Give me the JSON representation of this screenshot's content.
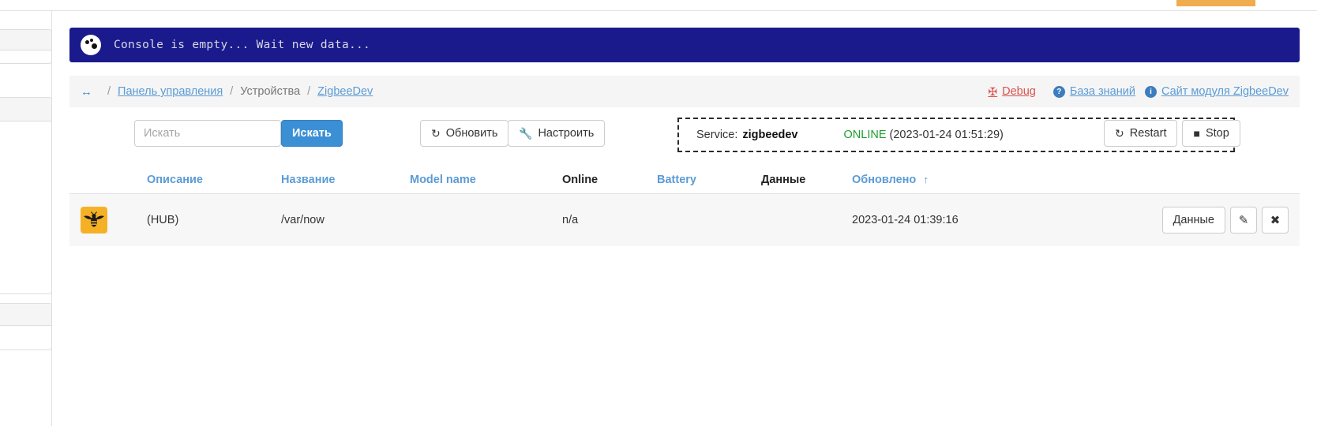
{
  "console": {
    "icon": "console-dots-icon",
    "message": "Console is empty... Wait new data..."
  },
  "breadcrumb": {
    "toggle_icon": "arrows-left-right-icon",
    "sep": "/",
    "items": [
      {
        "label": "Панель управления",
        "type": "link"
      },
      {
        "label": "Устройства",
        "type": "plain"
      },
      {
        "label": "ZigbeeDev",
        "type": "link"
      }
    ],
    "actions": {
      "debug_label": "Debug",
      "debug_icon": "crosshair-icon",
      "debug_color": "#d9534f",
      "kb_badge": "?",
      "kb_label": "База знаний",
      "site_badge": "i",
      "site_label": "Сайт модуля ZigbeeDev",
      "link_color": "#5b9bd5"
    }
  },
  "toolbar": {
    "search_placeholder": "Искать",
    "search_value": "",
    "search_button": "Искать",
    "refresh_label": "Обновить",
    "refresh_icon": "refresh-icon",
    "config_label": "Настроить",
    "config_icon": "wrench-icon",
    "primary_color": "#3b8fd4"
  },
  "service": {
    "label": "Service:",
    "name": "zigbeedev",
    "status": "ONLINE",
    "status_color": "#1f9d2f",
    "timestamp": "(2023-01-24 01:51:29)",
    "restart_label": "Restart",
    "restart_icon": "refresh-icon",
    "stop_label": "Stop",
    "stop_icon": "square-stop-icon"
  },
  "table": {
    "columns": [
      {
        "key": "icon",
        "label": "",
        "type": "plain"
      },
      {
        "key": "desc",
        "label": "Описание",
        "type": "link"
      },
      {
        "key": "name",
        "label": "Название",
        "type": "link"
      },
      {
        "key": "model",
        "label": "Model name",
        "type": "link"
      },
      {
        "key": "online",
        "label": "Online",
        "type": "plain"
      },
      {
        "key": "batt",
        "label": "Battery",
        "type": "link"
      },
      {
        "key": "data",
        "label": "Данные",
        "type": "plain"
      },
      {
        "key": "upd",
        "label": "Обновлено",
        "type": "link",
        "sort": "↑"
      }
    ],
    "rows": [
      {
        "icon": "bee-device-icon",
        "desc": "(HUB)",
        "name": "/var/now",
        "model": "",
        "online": "n/a",
        "batt": "",
        "data": "",
        "upd": "2023-01-24 01:39:16",
        "actions": {
          "data_label": "Данные",
          "edit_icon": "pencil-icon",
          "delete_icon": "close-x-icon"
        }
      }
    ]
  }
}
